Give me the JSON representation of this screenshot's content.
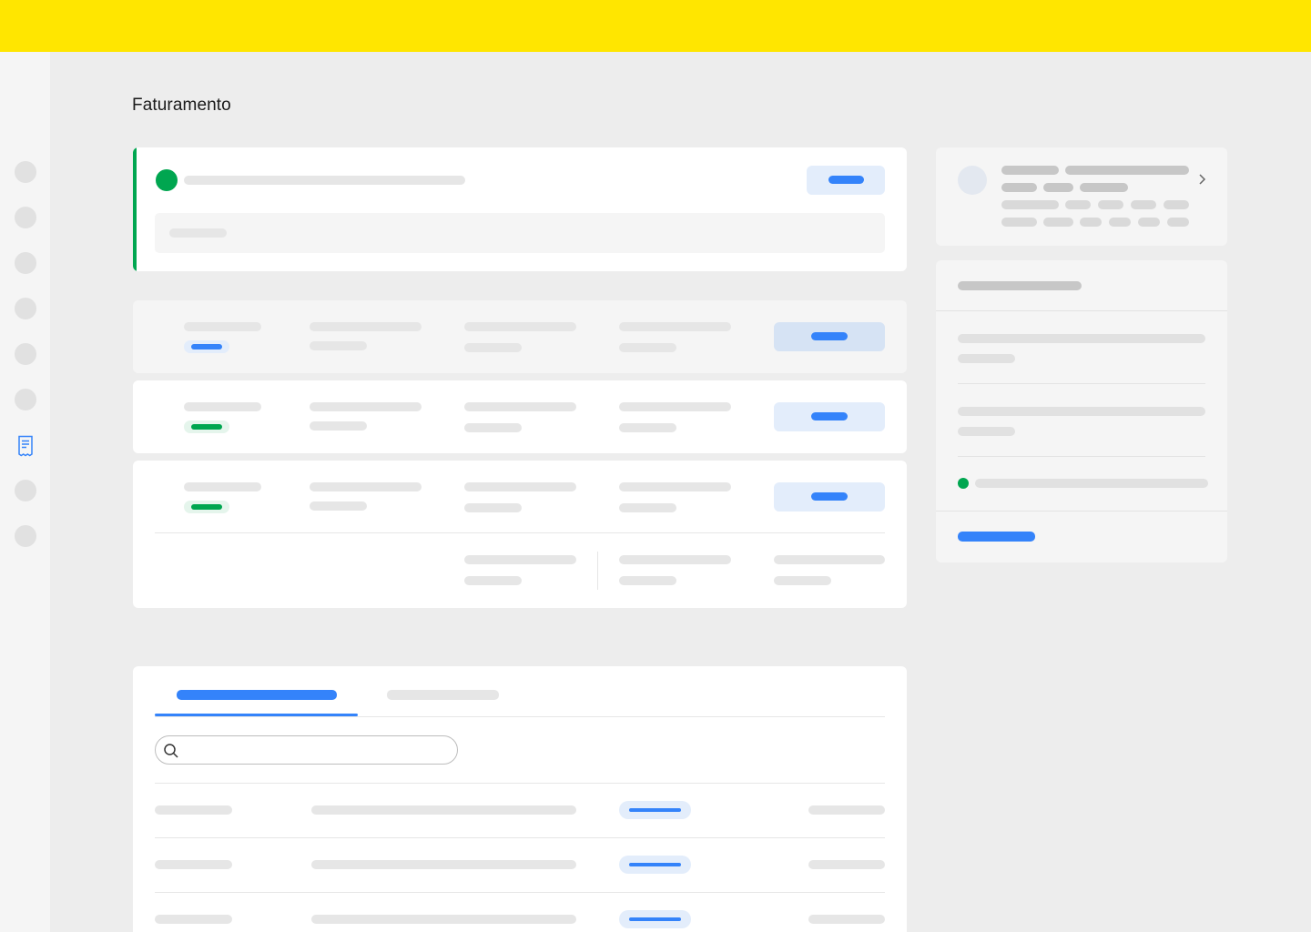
{
  "header": {
    "brand_color": "#ffe600"
  },
  "sidebar": {
    "items": [
      {
        "icon": "nav-placeholder-icon",
        "active": false
      },
      {
        "icon": "nav-placeholder-icon",
        "active": false
      },
      {
        "icon": "nav-placeholder-icon",
        "active": false
      },
      {
        "icon": "nav-placeholder-icon",
        "active": false
      },
      {
        "icon": "nav-placeholder-icon",
        "active": false
      },
      {
        "icon": "nav-placeholder-icon",
        "active": false
      },
      {
        "icon": "receipt-icon",
        "active": true
      },
      {
        "icon": "nav-placeholder-icon",
        "active": false
      },
      {
        "icon": "nav-placeholder-icon",
        "active": false
      }
    ],
    "active_color": "#3483fa"
  },
  "page": {
    "title": "Faturamento"
  },
  "status_card": {
    "status_color": "#00a650",
    "accent_color": "#00a650"
  },
  "billing_rows": [
    {
      "badge_color": "#3483fa",
      "highlighted": true
    },
    {
      "badge_color": "#00a650",
      "highlighted": false
    },
    {
      "badge_color": "#00a650",
      "highlighted": false,
      "has_details": true
    }
  ],
  "account_card": {
    "icon": "chevron-right-icon"
  },
  "summary_card": {
    "dot_color": "#00a650",
    "link_color": "#3483fa"
  },
  "tabs": {
    "active_index": 0,
    "count": 2
  },
  "search": {
    "icon": "search-icon",
    "placeholder": ""
  },
  "table": {
    "row_count": 3
  },
  "colors": {
    "accent": "#3483fa",
    "success": "#00a650",
    "skeleton": "#e6e6e6",
    "skeleton_dark": "#c7c7c7"
  }
}
